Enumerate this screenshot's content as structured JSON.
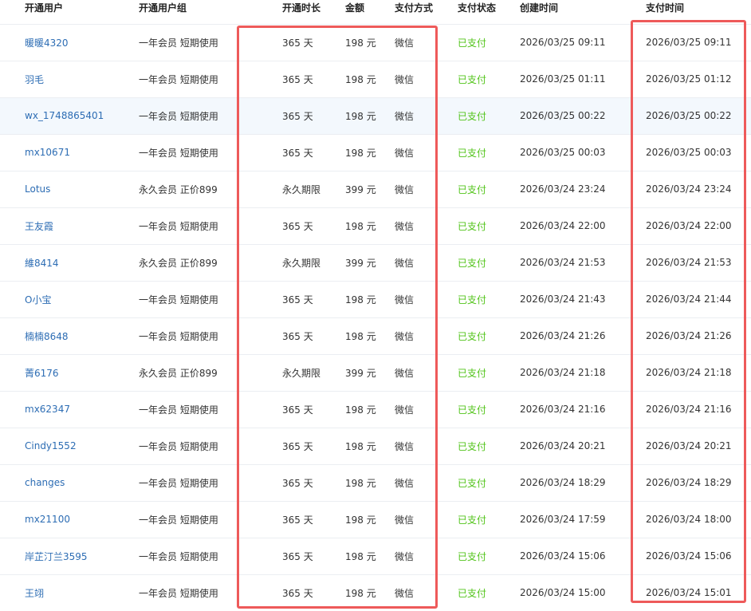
{
  "headers": {
    "user": "开通用户",
    "group": "开通用户组",
    "duration": "开通时长",
    "amount": "金额",
    "pay_method": "支付方式",
    "pay_status": "支付状态",
    "created": "创建时间",
    "paid": "支付时间"
  },
  "rows": [
    {
      "user": "暖暖4320",
      "group": "一年会员 短期使用",
      "duration": "365 天",
      "amount": "198 元",
      "method": "微信",
      "status": "已支付",
      "created": "2026/03/25 09:11",
      "paid": "2026/03/25 09:11"
    },
    {
      "user": "羽毛",
      "group": "一年会员 短期使用",
      "duration": "365 天",
      "amount": "198 元",
      "method": "微信",
      "status": "已支付",
      "created": "2026/03/25 01:11",
      "paid": "2026/03/25 01:12"
    },
    {
      "user": "wx_1748865401",
      "group": "一年会员 短期使用",
      "duration": "365 天",
      "amount": "198 元",
      "method": "微信",
      "status": "已支付",
      "created": "2026/03/25 00:22",
      "paid": "2026/03/25 00:22"
    },
    {
      "user": "mx10671",
      "group": "一年会员 短期使用",
      "duration": "365 天",
      "amount": "198 元",
      "method": "微信",
      "status": "已支付",
      "created": "2026/03/25 00:03",
      "paid": "2026/03/25 00:03"
    },
    {
      "user": "Lotus",
      "group": "永久会员 正价899",
      "duration": "永久期限",
      "amount": "399 元",
      "method": "微信",
      "status": "已支付",
      "created": "2026/03/24 23:24",
      "paid": "2026/03/24 23:24"
    },
    {
      "user": "王友霞",
      "group": "一年会员 短期使用",
      "duration": "365 天",
      "amount": "198 元",
      "method": "微信",
      "status": "已支付",
      "created": "2026/03/24 22:00",
      "paid": "2026/03/24 22:00"
    },
    {
      "user": "維8414",
      "group": "永久会员 正价899",
      "duration": "永久期限",
      "amount": "399 元",
      "method": "微信",
      "status": "已支付",
      "created": "2026/03/24 21:53",
      "paid": "2026/03/24 21:53"
    },
    {
      "user": "O小宝",
      "group": "一年会员 短期使用",
      "duration": "365 天",
      "amount": "198 元",
      "method": "微信",
      "status": "已支付",
      "created": "2026/03/24 21:43",
      "paid": "2026/03/24 21:44"
    },
    {
      "user": "楠楠8648",
      "group": "一年会员 短期使用",
      "duration": "365 天",
      "amount": "198 元",
      "method": "微信",
      "status": "已支付",
      "created": "2026/03/24 21:26",
      "paid": "2026/03/24 21:26"
    },
    {
      "user": "菁6176",
      "group": "永久会员 正价899",
      "duration": "永久期限",
      "amount": "399 元",
      "method": "微信",
      "status": "已支付",
      "created": "2026/03/24 21:18",
      "paid": "2026/03/24 21:18"
    },
    {
      "user": "mx62347",
      "group": "一年会员 短期使用",
      "duration": "365 天",
      "amount": "198 元",
      "method": "微信",
      "status": "已支付",
      "created": "2026/03/24 21:16",
      "paid": "2026/03/24 21:16"
    },
    {
      "user": "Cindy1552",
      "group": "一年会员 短期使用",
      "duration": "365 天",
      "amount": "198 元",
      "method": "微信",
      "status": "已支付",
      "created": "2026/03/24 20:21",
      "paid": "2026/03/24 20:21"
    },
    {
      "user": "changes",
      "group": "一年会员 短期使用",
      "duration": "365 天",
      "amount": "198 元",
      "method": "微信",
      "status": "已支付",
      "created": "2026/03/24 18:29",
      "paid": "2026/03/24 18:29"
    },
    {
      "user": "mx21100",
      "group": "一年会员 短期使用",
      "duration": "365 天",
      "amount": "198 元",
      "method": "微信",
      "status": "已支付",
      "created": "2026/03/24 17:59",
      "paid": "2026/03/24 18:00"
    },
    {
      "user": "岸芷汀兰3595",
      "group": "一年会员 短期使用",
      "duration": "365 天",
      "amount": "198 元",
      "method": "微信",
      "status": "已支付",
      "created": "2026/03/24 15:06",
      "paid": "2026/03/24 15:06"
    },
    {
      "user": "王翊",
      "group": "一年会员 短期使用",
      "duration": "365 天",
      "amount": "198 元",
      "method": "微信",
      "status": "已支付",
      "created": "2026/03/24 15:00",
      "paid": "2026/03/24 15:01"
    }
  ],
  "highlight_row": 2,
  "colors": {
    "link": "#2d6db4",
    "status_paid": "#52c41a",
    "annotation": "#ee5a5a",
    "row_highlight": "#f3f8fd"
  }
}
